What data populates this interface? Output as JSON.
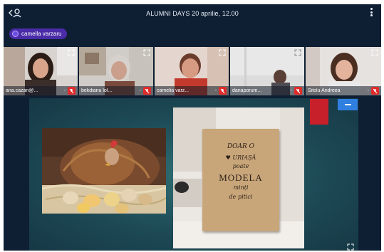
{
  "header": {
    "title": "ALUMNI DAYS 20 aprilie, 12.00",
    "back_icon": "back-people-icon",
    "more_icon": "more-vertical-icon"
  },
  "active_speaker": {
    "name": "camella varzaru",
    "icon": "speaker-icon"
  },
  "participants": [
    {
      "name": "ana.cazan@...",
      "options": "-",
      "muted": true,
      "active": false
    },
    {
      "name": "bekdianu lol...",
      "options": "-",
      "muted": true,
      "active": false
    },
    {
      "name": "camelia varz...",
      "options": "-",
      "muted": true,
      "active": true
    },
    {
      "name": "danaporum...",
      "options": "-",
      "muted": true,
      "active": false
    },
    {
      "name": "Sitolu Andreea",
      "options": "-",
      "muted": true,
      "active": false
    }
  ],
  "card": {
    "line1": "DOAR O",
    "line2": "♥ URIAȘĂ",
    "line3": "poate",
    "line4": "MODELA",
    "line5": "minți",
    "line6": "de pitici"
  },
  "colors": {
    "background": "#0f1f33",
    "speaker_pill": "#4a2ba8",
    "active_outline": "#2f80ed",
    "mute_badge": "#e02b2b",
    "stage": "#1d4a55",
    "red_tab": "#c8202a",
    "blue_tab": "#2f7fe0"
  }
}
